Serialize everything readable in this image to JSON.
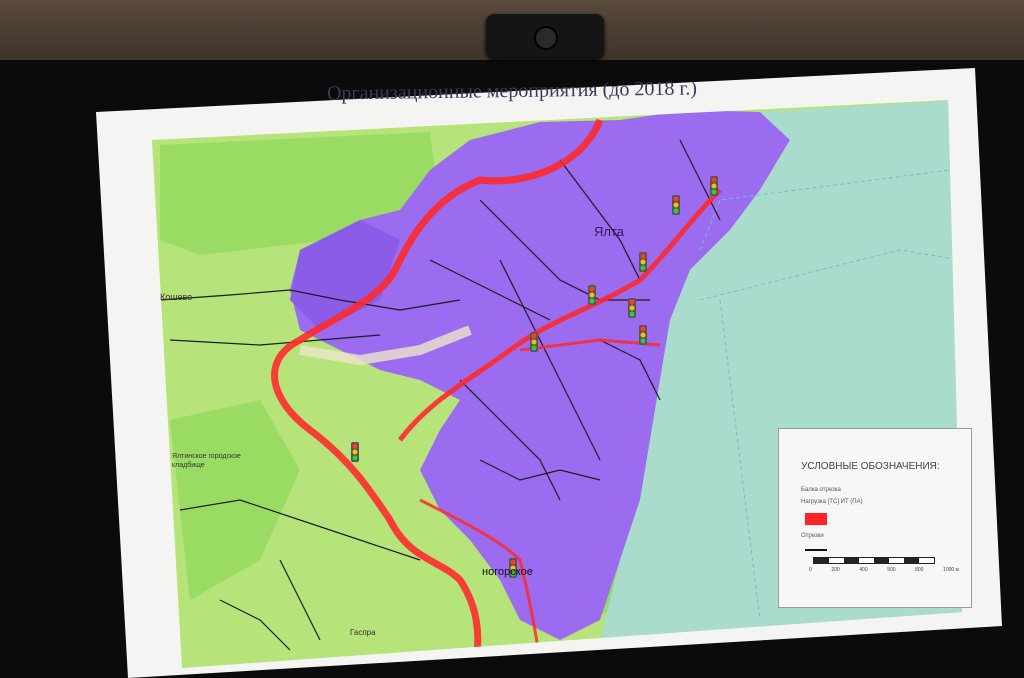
{
  "slide": {
    "title": "Организационные мероприятия (до 2018 г.)"
  },
  "map": {
    "city_label": "Ялта",
    "district_label": "Гаспра",
    "lower_label": "ногорское",
    "left_label": "Кошево",
    "cemetery_label": "Ялтинское городское кладбище"
  },
  "legend": {
    "title": "УСЛОВНЫЕ ОБОЗНАЧЕНИЯ:",
    "item1": "Балка отрезка",
    "item2": "Нагрузка [ТС] ИТ (ПА)",
    "item3": "Отрезки",
    "scale_labels": [
      "0",
      "200",
      "400",
      "500",
      "800",
      "1000 м"
    ]
  },
  "colors": {
    "land": "#b6e37a",
    "urban": "#9b6bf0",
    "sea": "#a9dccc",
    "route": "#ff2a2a",
    "road": "#1d1d1d"
  }
}
